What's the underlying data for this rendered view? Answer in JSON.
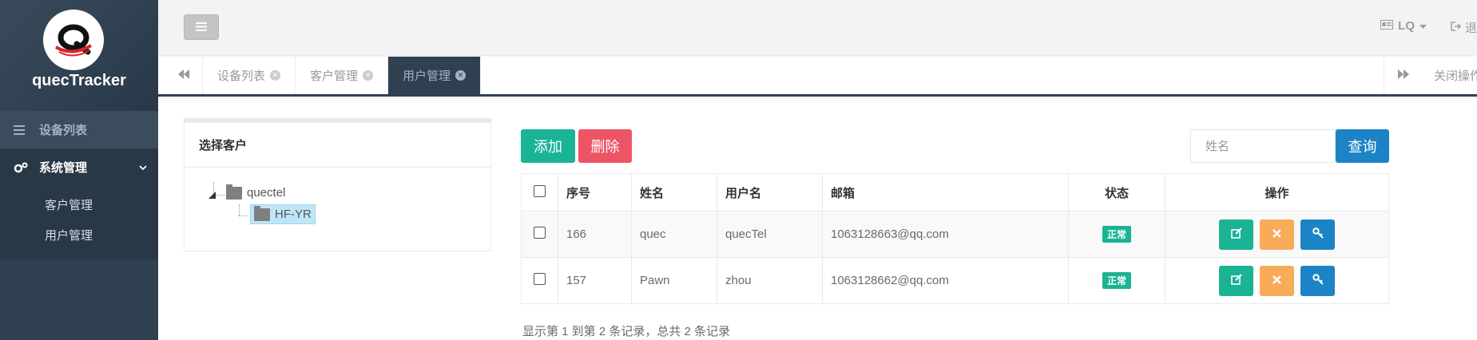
{
  "app": {
    "brand": "quecTracker"
  },
  "sidebar": {
    "items": [
      {
        "label": "设备列表",
        "icon": "list-icon"
      },
      {
        "label": "系统管理",
        "icon": "gears-icon"
      }
    ],
    "sub_items": [
      {
        "label": "客户管理"
      },
      {
        "label": "用户管理"
      }
    ]
  },
  "topbar": {
    "user": "LQ",
    "logout": "退"
  },
  "tabs": [
    {
      "label": "设备列表",
      "active": false
    },
    {
      "label": "客户管理",
      "active": false
    },
    {
      "label": "用户管理",
      "active": true
    }
  ],
  "tabbar": {
    "close_ops": "关闭操作"
  },
  "panel": {
    "title": "选择客户",
    "tree": [
      {
        "label": "quectel",
        "selected": false
      },
      {
        "label": "HF-YR",
        "selected": true
      }
    ]
  },
  "toolbar": {
    "add": "添加",
    "delete": "删除",
    "search_placeholder": "姓名",
    "query": "查询"
  },
  "table": {
    "headers": [
      "序号",
      "姓名",
      "用户名",
      "邮箱",
      "状态",
      "操作"
    ],
    "rows": [
      {
        "id": "166",
        "name": "quec",
        "username": "quecTel",
        "email": "1063128663@qq.com",
        "status": "正常"
      },
      {
        "id": "157",
        "name": "Pawn",
        "username": "zhou",
        "email": "1063128662@qq.com",
        "status": "正常"
      }
    ]
  },
  "pagination": {
    "info": "显示第 1 到第 2 条记录，总共 2 条记录"
  },
  "colors": {
    "sidebar": "#2f4050",
    "primary": "#1ab394",
    "danger": "#ed5565",
    "info": "#1c84c6",
    "warning": "#f8ac59"
  }
}
